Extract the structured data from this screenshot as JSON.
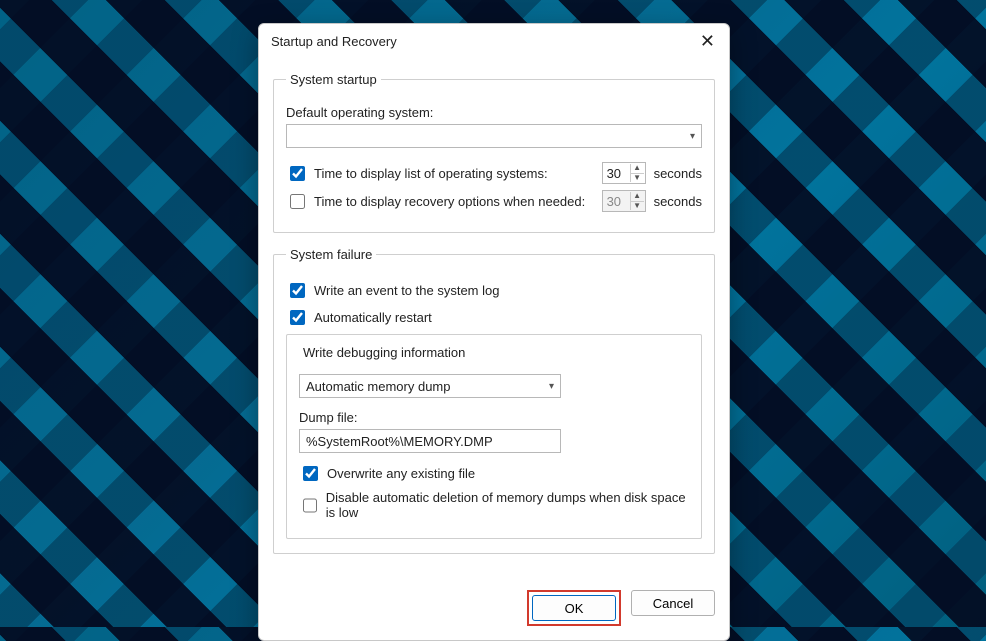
{
  "dialog": {
    "title": "Startup and Recovery"
  },
  "startup": {
    "legend": "System startup",
    "default_os_label": "Default operating system:",
    "default_os_value": "",
    "time_os_label": "Time to display list of operating systems:",
    "time_os_checked": true,
    "time_os_value": "30",
    "time_os_unit": "seconds",
    "time_recovery_label": "Time to display recovery options when needed:",
    "time_recovery_checked": false,
    "time_recovery_value": "30",
    "time_recovery_unit": "seconds"
  },
  "failure": {
    "legend": "System failure",
    "write_event_label": "Write an event to the system log",
    "write_event_checked": true,
    "auto_restart_label": "Automatically restart",
    "auto_restart_checked": true,
    "debug_legend": "Write debugging information",
    "dump_type_value": "Automatic memory dump",
    "dump_file_label": "Dump file:",
    "dump_file_value": "%SystemRoot%\\MEMORY.DMP",
    "overwrite_label": "Overwrite any existing file",
    "overwrite_checked": true,
    "disable_delete_label": "Disable automatic deletion of memory dumps when disk space is low",
    "disable_delete_checked": false
  },
  "buttons": {
    "ok": "OK",
    "cancel": "Cancel"
  }
}
